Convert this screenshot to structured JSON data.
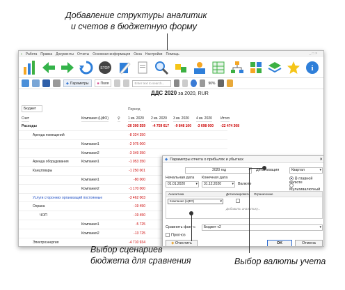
{
  "captions": {
    "top": [
      "Добавление структуры аналитик",
      "и счетов в бюджетную форму"
    ],
    "bottom_left": [
      "Выбор сценариев",
      "бюджета для сравнения"
    ],
    "bottom_right": "Выбор валюты учета"
  },
  "window": {
    "menu": [
      "Работа",
      "Правка",
      "Документы",
      "Отчеты",
      "Основная информация",
      "Окна",
      "Настройки",
      "Помощь"
    ],
    "window_controls": "_ □ ×",
    "toolbar": {
      "params_label": "Параметры",
      "fields_label": "Поля",
      "search_placeholder": "Enter text to search...",
      "zoom": "90%"
    },
    "report": {
      "title": "ДДС 2020",
      "subtitle": "за 2020, RUR"
    },
    "budget_label": "Бюджет",
    "grid": {
      "period_header": "Период",
      "col_account": "Счет",
      "col_company": "Компания (ЦФО)",
      "col_periods": [
        "1 кв. 2020",
        "2 кв. 2020",
        "3 кв. 2020",
        "4 кв. 2020",
        "Итого"
      ],
      "first_row": {
        "name": "Расходы",
        "values": [
          "-20 300 559",
          "-4 759 617",
          "-9 848 100",
          "-3 698 000",
          "-22 474 308"
        ]
      },
      "rows": [
        {
          "name": "Аренда помещений",
          "company": "",
          "value": "-8 324 350"
        },
        {
          "name": "",
          "company": "Компания1",
          "value": "-2 975 000"
        },
        {
          "name": "",
          "company": "Компания2",
          "value": "-3 349 350"
        },
        {
          "name": "Аренда оборудования",
          "company": "Компания1",
          "value": "-1 053 350"
        },
        {
          "name": "Канцтовары",
          "company": "",
          "value": "-1 250 001"
        },
        {
          "name": "",
          "company": "Компания1",
          "value": "-80 000"
        },
        {
          "name": "",
          "company": "Компания2",
          "value": "-1 170 000"
        },
        {
          "name": "Услуги сторонних организаций постоянные",
          "company": "",
          "value": "-3 462 003"
        },
        {
          "name": "Охрана",
          "company": "",
          "value": "-19 450"
        },
        {
          "name": "ЧОП",
          "company": "",
          "value": "-19 450"
        },
        {
          "name": "",
          "company": "Компания1",
          "value": "-5 725"
        },
        {
          "name": "",
          "company": "Компания2",
          "value": "-13 725"
        },
        {
          "name": "Электроэнергия",
          "company": "",
          "value": "-4 710 934"
        }
      ]
    }
  },
  "dialog": {
    "title": "Параметры отчета о прибылях и убытках",
    "year": "2020 год",
    "detail_label": "Детализация",
    "detail_value": "Квартал",
    "start_label": "Начальная дата",
    "end_label": "Конечная дата",
    "start_value": "01.01.2020",
    "end_value": "31.12.2020",
    "currency_label": "Валюте",
    "currency_options": [
      "В главной валюте",
      "Мультивалютный"
    ],
    "table": {
      "col_analytics": "Аналитика",
      "col_detail": "Детализировать",
      "col_limit": "Ограничение",
      "row_company": "Компания (ЦФО)",
      "add_text": "Добавить аналитику..."
    },
    "compare_label": "Сравнить факт с",
    "compare_value": "Бюджет v2",
    "forecast_label": "Прогноз",
    "clear_label": "Очистить",
    "ok_label": "OK",
    "cancel_label": "Отмена"
  }
}
